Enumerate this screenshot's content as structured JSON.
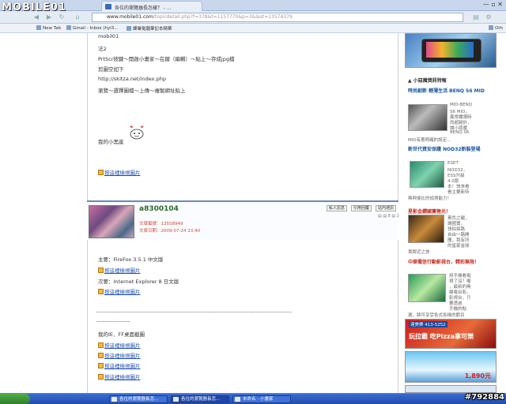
{
  "logo": "MOBILE01",
  "tab": {
    "title": "各位的瀏覽器長怎樣？ - ..."
  },
  "window_controls": "— ▫ ✕",
  "address": {
    "host": "www.mobile01.com",
    "path": "/topicdetail.php?f=378&t=1157770&p=3&last=13574379"
  },
  "bookmarks": [
    {
      "label": "New Tab"
    },
    {
      "label": "Gmail - Inbox (hyl3..."
    },
    {
      "label": "課業電腦筆記本精華"
    },
    {
      "label": "Oth"
    }
  ],
  "post_top": {
    "lines": [
      "mobil01",
      "法2",
      "PrtScr按鍵～開啟小畫家～在鍵（編輯）～貼上～存成jpg檔",
      "剪圖空如下",
      "http://skitza.net/index.php",
      "瀏覽～選擇圖檔～上傳～複製網址貼上"
    ],
    "my_avatar_label": "我的小黑座",
    "image_link": "按這裡檢視圖片"
  },
  "author": {
    "name": "a8300104",
    "posts_label": "文章編號：13558949",
    "date_label": "文章日期：2009-07-24 23:40",
    "buttons": [
      "私人訊息",
      "引用回覆",
      "站內通訊"
    ],
    "page_tag": "▤ ▤ 8 ▤ 2"
  },
  "post_bottom": {
    "main_label": "主要：FireFox 3.5.1 中文版",
    "link1": "按這裡檢視圖片",
    "secondary_label": "次要：Internet Explorer 8 日文版",
    "link2": "按這裡檢視圖片",
    "dash_line": "------------------------------------------------------------------------------------------------------------------",
    "dash_line2": "--------------------",
    "ie_ff_label": "我的IE．FF桌面截圖",
    "links": [
      "按這裡檢視圖片",
      "按這裡檢視圖片",
      "按這裡檢視圖片",
      "按這裡檢視圖片"
    ]
  },
  "sidebar": {
    "header": "▲ 小惡魔資訊特報",
    "items": [
      {
        "title": "時尚創新 輕薄生活 BENQ S6 MID",
        "desc": [
          "MID-BENQ",
          "S6 MID，",
          "異常纖薄時",
          "尚超越計，",
          "讓小惡魔",
          "BENQ S6",
          "MID有著明確的設定..."
        ]
      },
      {
        "title": "新世代資安保護 NOD32新裝登場",
        "desc": [
          "ESET",
          "NOD32，",
          "ESS升級",
          "4.0版",
          "本！快來看",
          "看主要新特"
        ],
        "extra": "無與倫比的偵測能力！"
      },
      {
        "title": "星影金鑽國寶極光！",
        "desc": [
          "黃色之戰，",
          "讓國寶，",
          "快拍探路",
          "自由一路開",
          "團，我有所",
          "的星家金球"
        ],
        "extra": "貴鄰近之旅"
      },
      {
        "title": "中華電信行動影視台，精彩無限！",
        "desc": [
          "用手機看電",
          "視了沒？喔",
          "，最新的無",
          "線電台影，",
          "影視台，只",
          "要透過",
          "手機的點"
        ],
        "extra": "選，跳可享受各式各樣的節目"
      }
    ],
    "ad1": "達美樂 413-5252",
    "ad2": "玩拉霸 吃Pizza拿可樂",
    "ad3": "1,890元"
  },
  "taskbar": {
    "items": [
      {
        "label": "各位的瀏覽器長怎..."
      },
      {
        "label": "各位的瀏覽器長怎..."
      },
      {
        "label": "未命名 - 小畫家"
      }
    ]
  },
  "watermark": "#792884"
}
